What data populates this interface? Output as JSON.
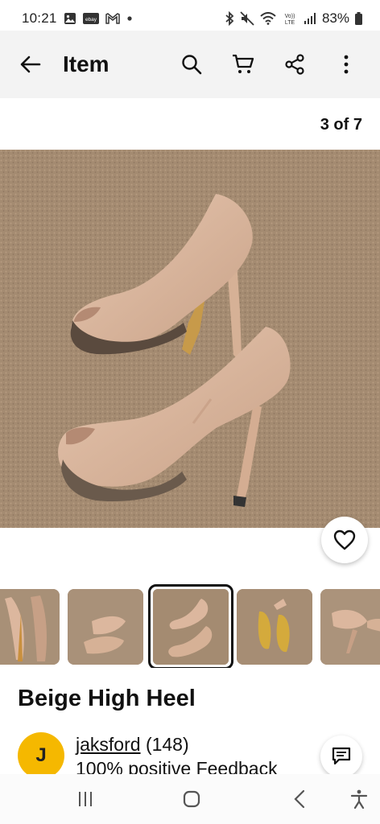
{
  "status_bar": {
    "time": "10:21",
    "left_icons": [
      "gallery-icon",
      "ebay-icon",
      "gmail-icon",
      "dot-icon"
    ],
    "right_icons": [
      "bluetooth-icon",
      "mute-icon",
      "wifi-icon",
      "volte-icon",
      "signal-icon"
    ],
    "volte_label": "Vo)) LTE",
    "battery": "83%",
    "ebay_label": "ebay"
  },
  "app_bar": {
    "title": "Item",
    "back_icon": "arrow-left-icon",
    "actions": [
      "search-icon",
      "cart-icon",
      "share-icon",
      "more-vert-icon"
    ]
  },
  "gallery": {
    "counter": "3 of 7",
    "thumbnails_count_visible": 5,
    "selected_thumbnail": 3
  },
  "listing": {
    "title": "Beige High Heel"
  },
  "seller": {
    "initial": "J",
    "name": "jaksford",
    "feedback_count": "(148)",
    "feedback_text": "100% positive Feedback"
  },
  "nav_bar": {
    "buttons": [
      "recents-icon",
      "home-icon",
      "back-icon",
      "accessibility-icon"
    ]
  },
  "colors": {
    "avatar": "#f5b800",
    "app_bar_bg": "#f3f3f3",
    "carpet": "#a48b71",
    "shoe": "#d9b59d"
  }
}
